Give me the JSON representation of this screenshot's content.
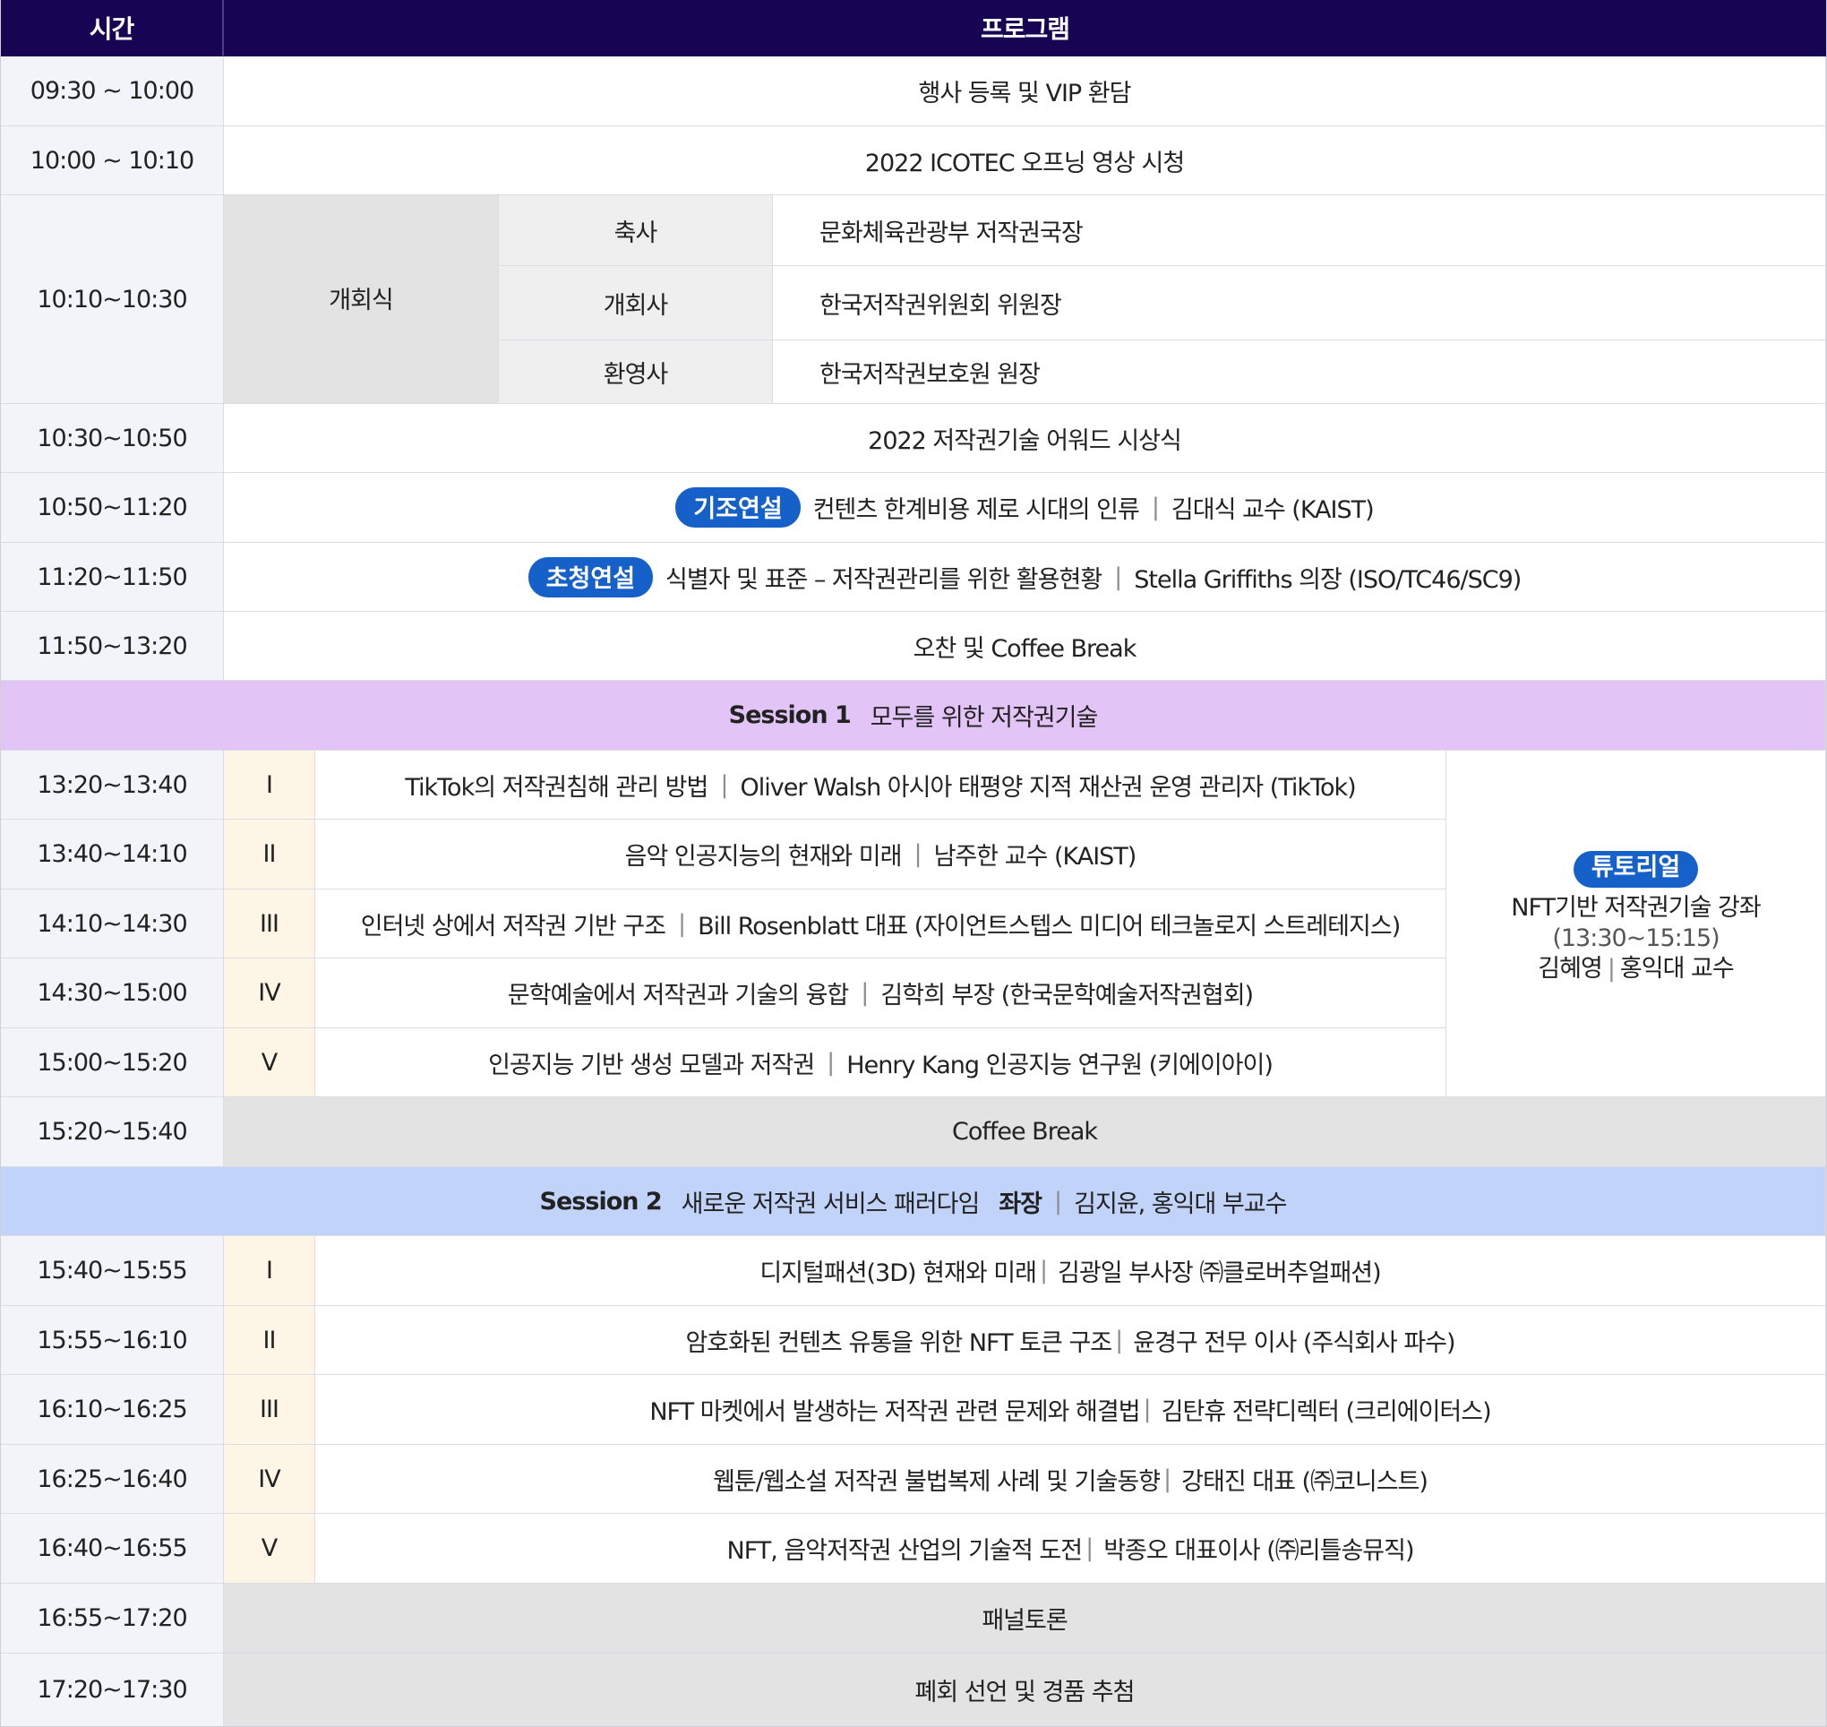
{
  "header": {
    "time_label": "시간",
    "program_label": "프로그램"
  },
  "rows": {
    "registration": {
      "time": "09:30 ~ 10:00",
      "title": "행사 등록 및 VIP 환담"
    },
    "opening_video": {
      "time": "10:00 ~ 10:10",
      "title": "2022 ICOTEC 오프닝 영상 시청"
    },
    "ceremony": {
      "time": "10:10~10:30",
      "label": "개회식",
      "items": [
        {
          "role": "축사",
          "speaker": "문화체육관광부 저작권국장"
        },
        {
          "role": "개회사",
          "speaker": "한국저작권위원회 위원장"
        },
        {
          "role": "환영사",
          "speaker": "한국저작권보호원 원장"
        }
      ]
    },
    "award": {
      "time": "10:30~10:50",
      "title": "2022 저작권기술 어워드 시상식"
    },
    "keynote": {
      "time": "10:50~11:20",
      "badge": "기조연설",
      "title": "컨텐츠 한계비용 제로 시대의 인류",
      "sep": "|",
      "speaker": "김대식 교수 (KAIST)"
    },
    "invited": {
      "time": "11:20~11:50",
      "badge": "초청연설",
      "title": "식별자 및 표준 – 저작권관리를 위한 활용현황",
      "sep": "|",
      "speaker": "Stella Griffiths 의장 (ISO/TC46/SC9)"
    },
    "lunch": {
      "time": "11:50~13:20",
      "title": "오찬 및 Coffee Break"
    }
  },
  "session1": {
    "label": "Session 1",
    "title": "모두를 위한 저작권기술",
    "talks": [
      {
        "time": "13:20~13:40",
        "num": "I",
        "title": "TikTok의 저작권침해 관리 방법",
        "sep": "|",
        "speaker": "Oliver Walsh 아시아 태평양 지적 재산권 운영 관리자 (TikTok)"
      },
      {
        "time": "13:40~14:10",
        "num": "II",
        "title": "음악 인공지능의 현재와 미래",
        "sep": "|",
        "speaker": "남주한 교수 (KAIST)"
      },
      {
        "time": "14:10~14:30",
        "num": "III",
        "title": "인터넷 상에서 저작권 기반 구조",
        "sep": "|",
        "speaker": "Bill Rosenblatt 대표 (자이언트스텝스 미디어 테크놀로지 스트레테지스)"
      },
      {
        "time": "14:30~15:00",
        "num": "IV",
        "title": "문학예술에서 저작권과 기술의 융합",
        "sep": "|",
        "speaker": "김학희 부장 (한국문학예술저작권협회)"
      },
      {
        "time": "15:00~15:20",
        "num": "V",
        "title": "인공지능 기반 생성 모델과 저작권",
        "sep": "|",
        "speaker": "Henry Kang 인공지능 연구원 (키에이아이)"
      }
    ],
    "tutorial": {
      "badge": "튜토리얼",
      "title": "NFT기반 저작권기술 강좌",
      "time": "(13:30~15:15)",
      "presenter": "김혜영",
      "sep": "|",
      "affiliation": "홍익대 교수"
    }
  },
  "break2": {
    "time": "15:20~15:40",
    "title": "Coffee Break"
  },
  "session2": {
    "label": "Session 2",
    "title": "새로운 저작권 서비스 패러다임",
    "chair_label": "좌장",
    "sep": "|",
    "chair": "김지윤, 홍익대 부교수",
    "talks": [
      {
        "time": "15:40~15:55",
        "num": "I",
        "title": "디지털패션(3D) 현재와 미래",
        "sep": "|",
        "speaker": "김광일 부사장 ㈜클로버추얼패션)"
      },
      {
        "time": "15:55~16:10",
        "num": "II",
        "title": "암호화된 컨텐츠 유통을 위한 NFT 토큰 구조",
        "sep": "|",
        "speaker": "윤경구 전무 이사 (주식회사 파수)"
      },
      {
        "time": "16:10~16:25",
        "num": "III",
        "title": "NFT 마켓에서 발생하는 저작권 관련 문제와 해결법",
        "sep": "|",
        "speaker": "김탄휴 전략디렉터 (크리에이터스)"
      },
      {
        "time": "16:25~16:40",
        "num": "IV",
        "title": "웹툰/웹소설 저작권 불법복제 사례 및 기술동향",
        "sep": "|",
        "speaker": "강태진 대표 (㈜코니스트)"
      },
      {
        "time": "16:40~16:55",
        "num": "V",
        "title": "NFT, 음악저작권 산업의 기술적 도전",
        "sep": "|",
        "speaker": "박종오 대표이사 (㈜리틀송뮤직)"
      }
    ]
  },
  "panel": {
    "time": "16:55~17:20",
    "title": "패널토론"
  },
  "closing": {
    "time": "17:20~17:30",
    "title": "폐회 선언 및 경품 추첨"
  },
  "colors": {
    "header": "#170553",
    "badge": "#1561c9",
    "session1": "#e2c4f7",
    "session2": "#c2d3fa",
    "break": "#e3e3e3",
    "time_col": "#f3f4f9",
    "roman_col": "#fdf6e6"
  }
}
